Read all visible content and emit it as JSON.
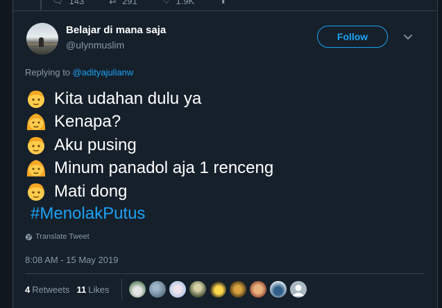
{
  "previous_tweet": {
    "reply_count": "143",
    "retweet_count": "291",
    "like_count": "1.9K",
    "icons": [
      "reply-icon",
      "retweet-icon",
      "like-icon",
      "share-icon"
    ]
  },
  "author": {
    "display_name": "Belajar di mana saja",
    "handle": "@ulynmuslim"
  },
  "follow_button": {
    "label": "Follow"
  },
  "replying_to": {
    "prefix": "Replying to",
    "user": "@adityajulianw"
  },
  "tweet": {
    "lines": [
      {
        "emoji": "boy-emoji",
        "text": "Kita udahan dulu ya"
      },
      {
        "emoji": "girl-emoji",
        "text": "Kenapa?"
      },
      {
        "emoji": "boy-emoji",
        "text": "Aku pusing"
      },
      {
        "emoji": "girl-emoji",
        "text": "Minum panadol aja 1 renceng"
      },
      {
        "emoji": "boy-emoji",
        "text": "Mati dong"
      }
    ],
    "hashtag": "#MenolakPutus"
  },
  "translate": {
    "label": "Translate Tweet"
  },
  "timestamp": "8:08 AM - 15 May 2019",
  "stats": {
    "retweets_count": "4",
    "retweets_label": "Retweets",
    "likes_count": "11",
    "likes_label": "Likes"
  },
  "colors": {
    "background": "#15202b",
    "accent": "#1da1f2",
    "secondary_text": "#8899a6",
    "border": "#38444d"
  }
}
